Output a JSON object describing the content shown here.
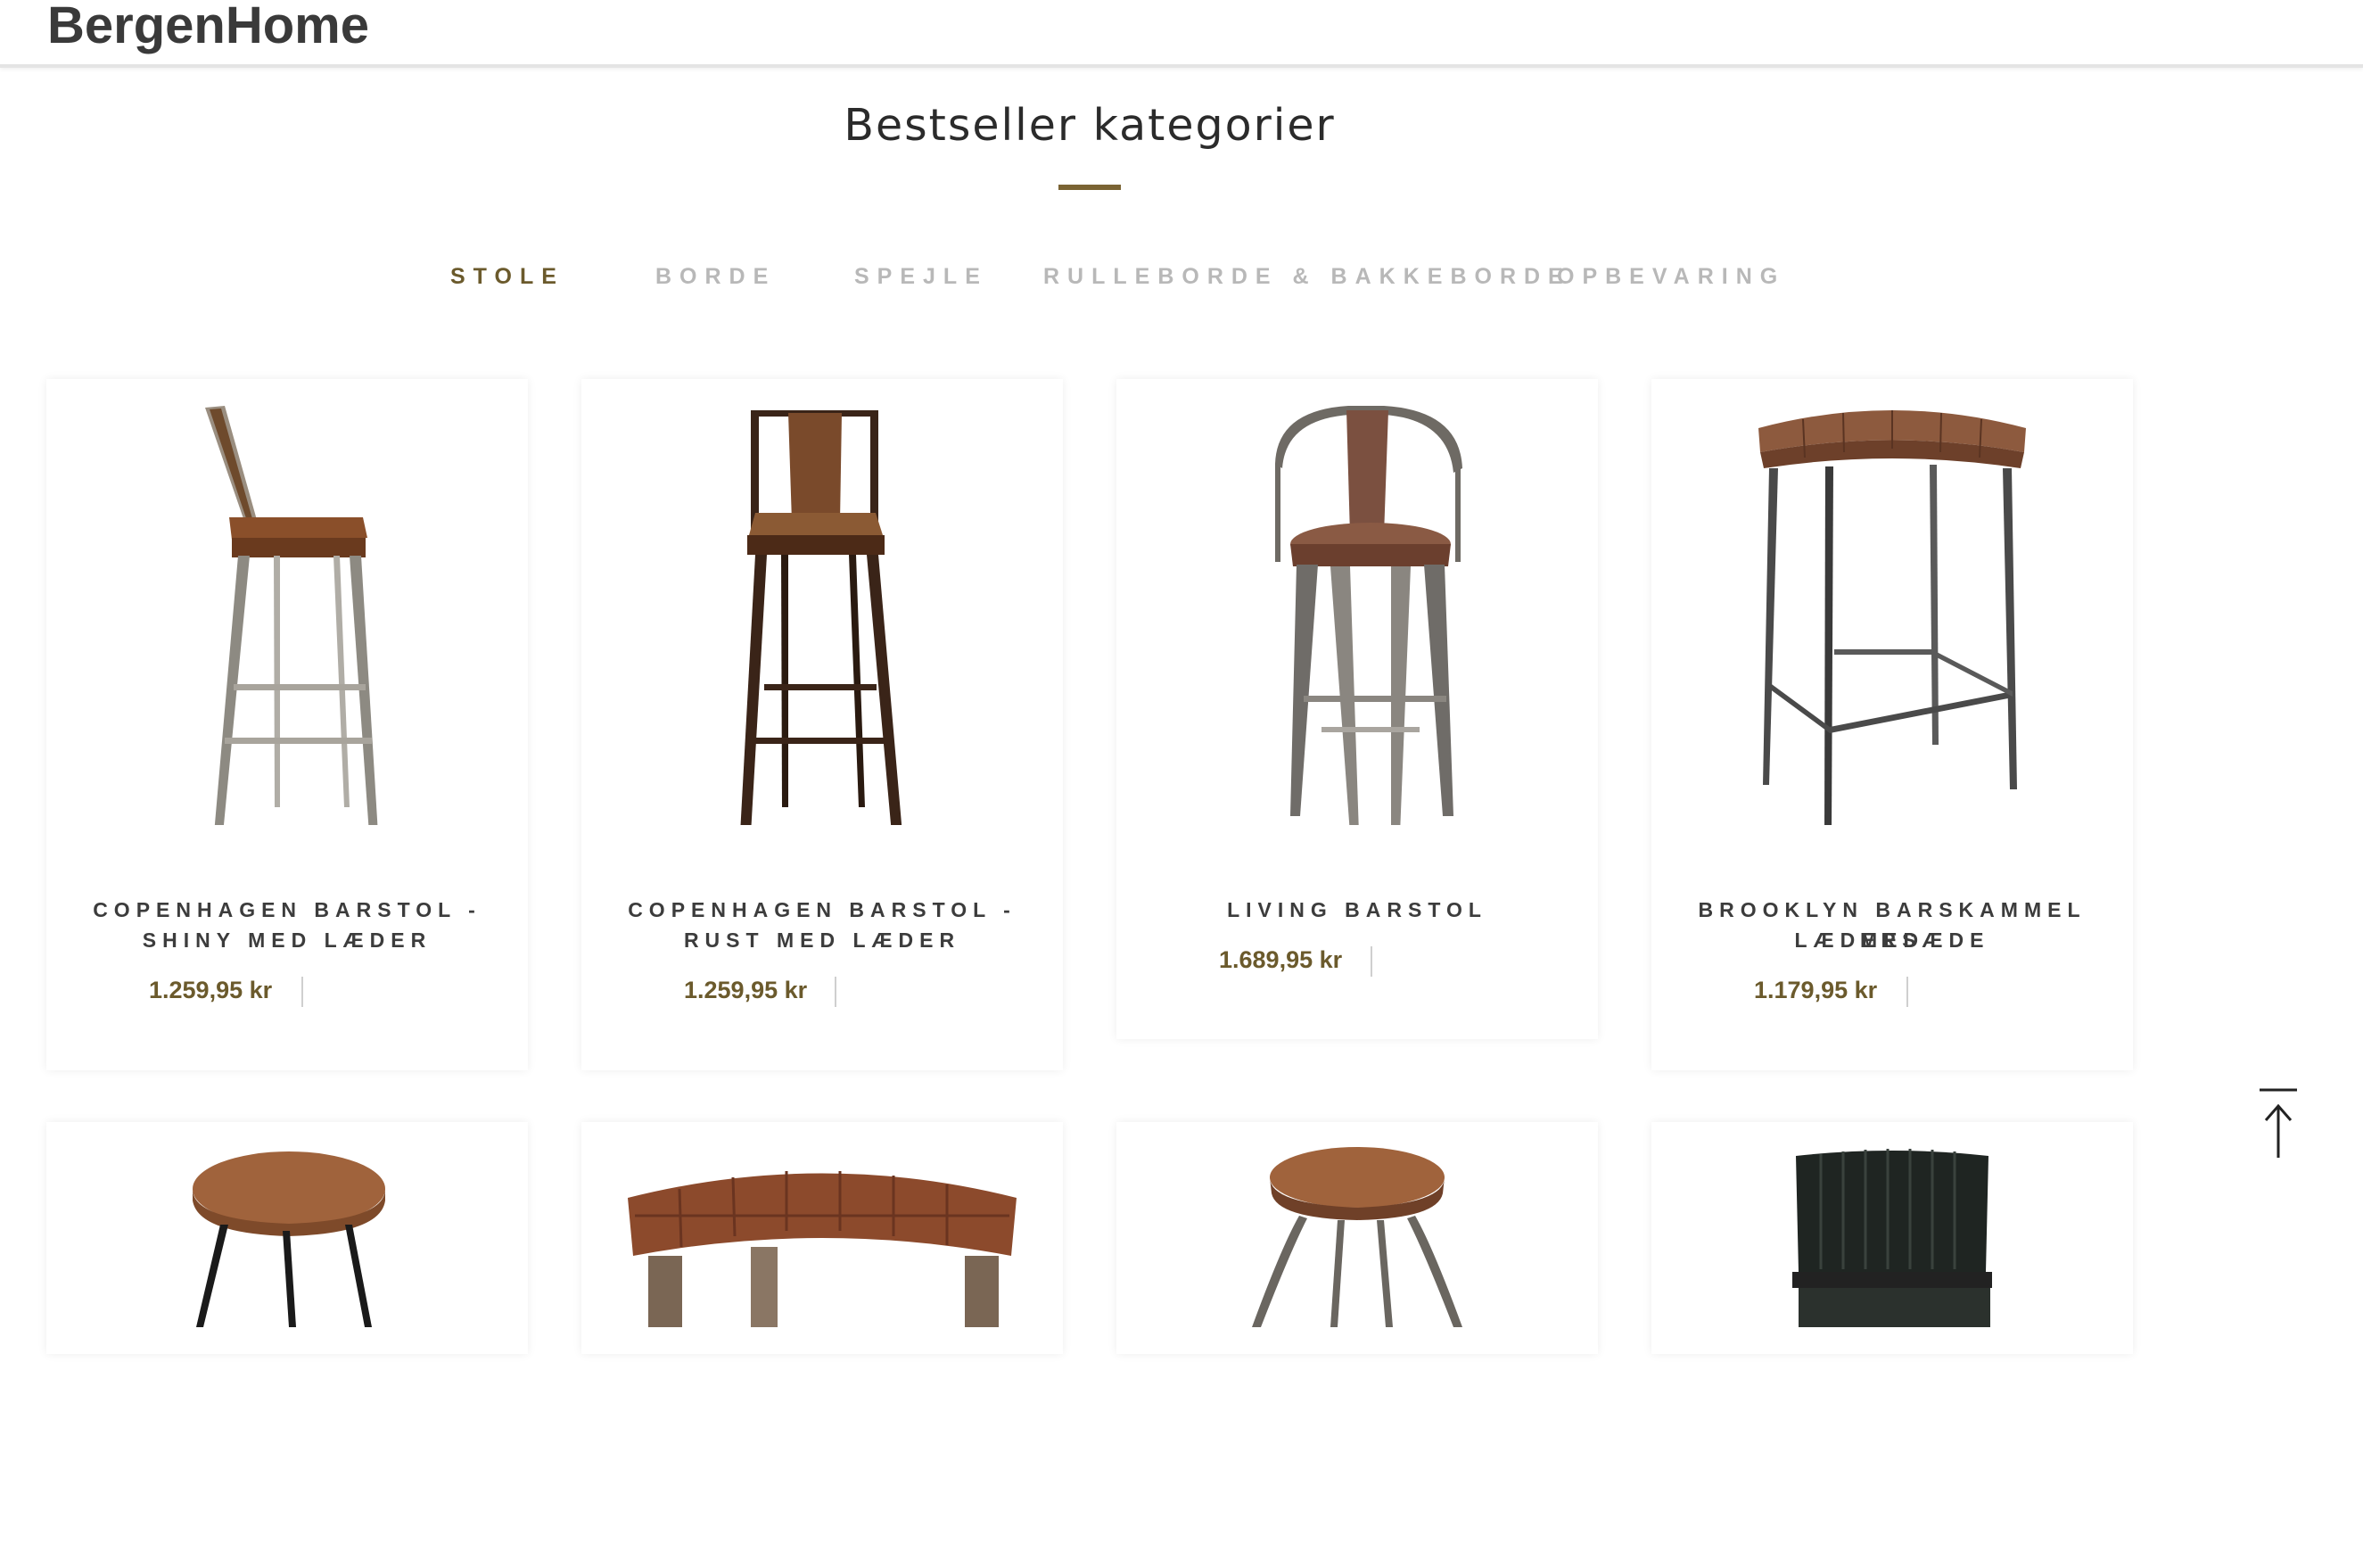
{
  "header": {
    "logo": "BergenHome"
  },
  "section": {
    "title": "Bestseller kategorier"
  },
  "tabs": [
    {
      "label": "STOLE",
      "active": true
    },
    {
      "label": "BORDE",
      "active": false
    },
    {
      "label": "SPEJLE",
      "active": false
    },
    {
      "label": "RULLEBORDE & BAKKEBORDE",
      "active": false
    },
    {
      "label": "OPBEVARING",
      "active": false
    }
  ],
  "products": [
    {
      "name_line1": "COPENHAGEN BARSTOL -",
      "name_line2": "SHINY MED LÆDER",
      "price": "1.259,95 kr"
    },
    {
      "name_line1": "COPENHAGEN BARSTOL -",
      "name_line2": "RUST MED LÆDER",
      "price": "1.259,95 kr"
    },
    {
      "name_line1": "LIVING BARSTOL",
      "name_line2": "",
      "price": "1.689,95 kr"
    },
    {
      "name_line1": "BROOKLYN BARSKAMMEL MED",
      "name_line2": "LÆDERSÆDE",
      "price": "1.179,95 kr"
    }
  ],
  "colors": {
    "accent": "#6b5a2c",
    "inactive_tab": "#b8b8b8",
    "underline": "#7a6333"
  },
  "icons": {
    "back_to_top": "arrow-up-to-line-icon"
  }
}
